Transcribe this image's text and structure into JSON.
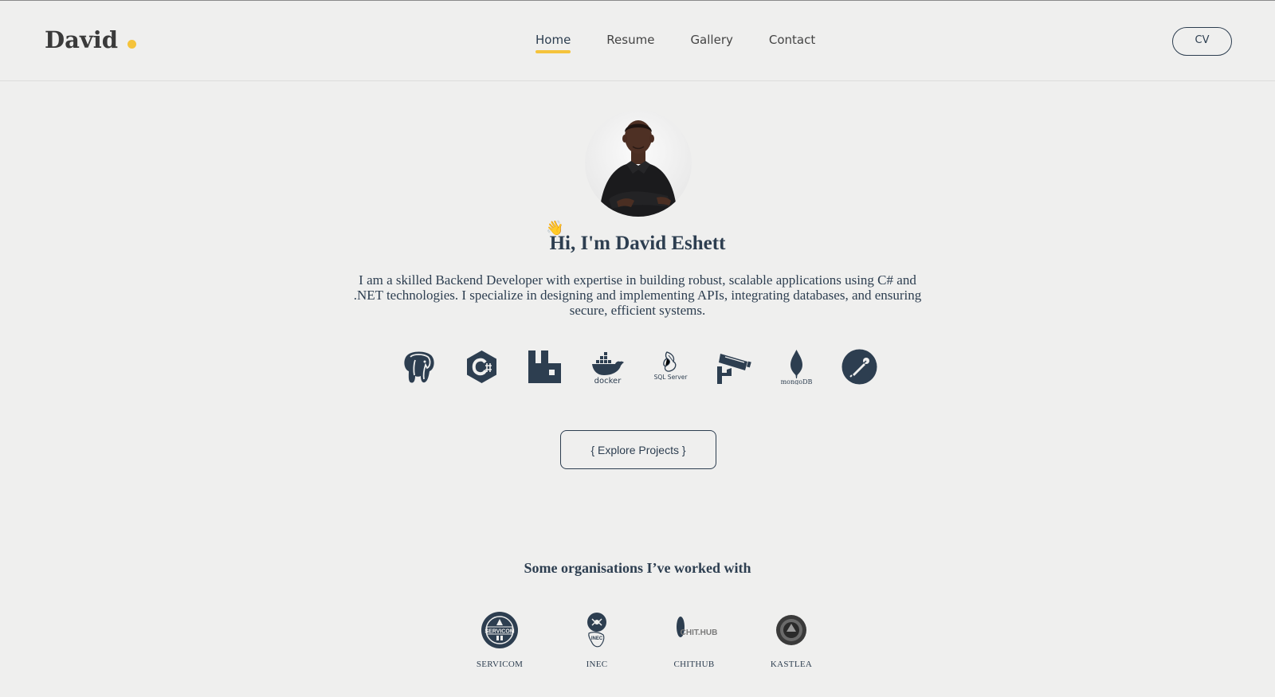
{
  "header": {
    "brand": "David",
    "nav": [
      {
        "label": "Home",
        "active": true
      },
      {
        "label": "Resume",
        "active": false
      },
      {
        "label": "Gallery",
        "active": false
      },
      {
        "label": "Contact",
        "active": false
      }
    ],
    "cv_button": "CV"
  },
  "hero": {
    "wave_emoji": "👋",
    "title": "Hi, I'm David Eshett",
    "description": "I am a skilled Backend Developer with expertise in building robust, scalable applications using C# and .NET technologies. I specialize in designing and implementing APIs, integrating databases, and ensuring secure, efficient systems.",
    "tech_icons": [
      {
        "name": "postgresql-icon"
      },
      {
        "name": "csharp-icon"
      },
      {
        "name": "rabbitmq-icon"
      },
      {
        "name": "docker-icon",
        "label": "docker"
      },
      {
        "name": "sql-server-icon",
        "label": "SQL Server"
      },
      {
        "name": "cctv-camera-icon"
      },
      {
        "name": "mongodb-icon",
        "label": "mongoDB"
      },
      {
        "name": "postman-icon"
      }
    ],
    "explore_button": "{ Explore Projects }"
  },
  "organisations": {
    "heading": "Some organisations I’ve worked with",
    "items": [
      {
        "name": "SERVICOM",
        "logo_text": "SERVICOM"
      },
      {
        "name": "INEC",
        "logo_text": "INEC"
      },
      {
        "name": "CHITHUB",
        "logo_text": "CHIT.HUB"
      },
      {
        "name": "KASTLEA"
      }
    ]
  },
  "colors": {
    "background": "#efefee",
    "primary": "#2d3e50",
    "accent": "#f5c33b"
  }
}
